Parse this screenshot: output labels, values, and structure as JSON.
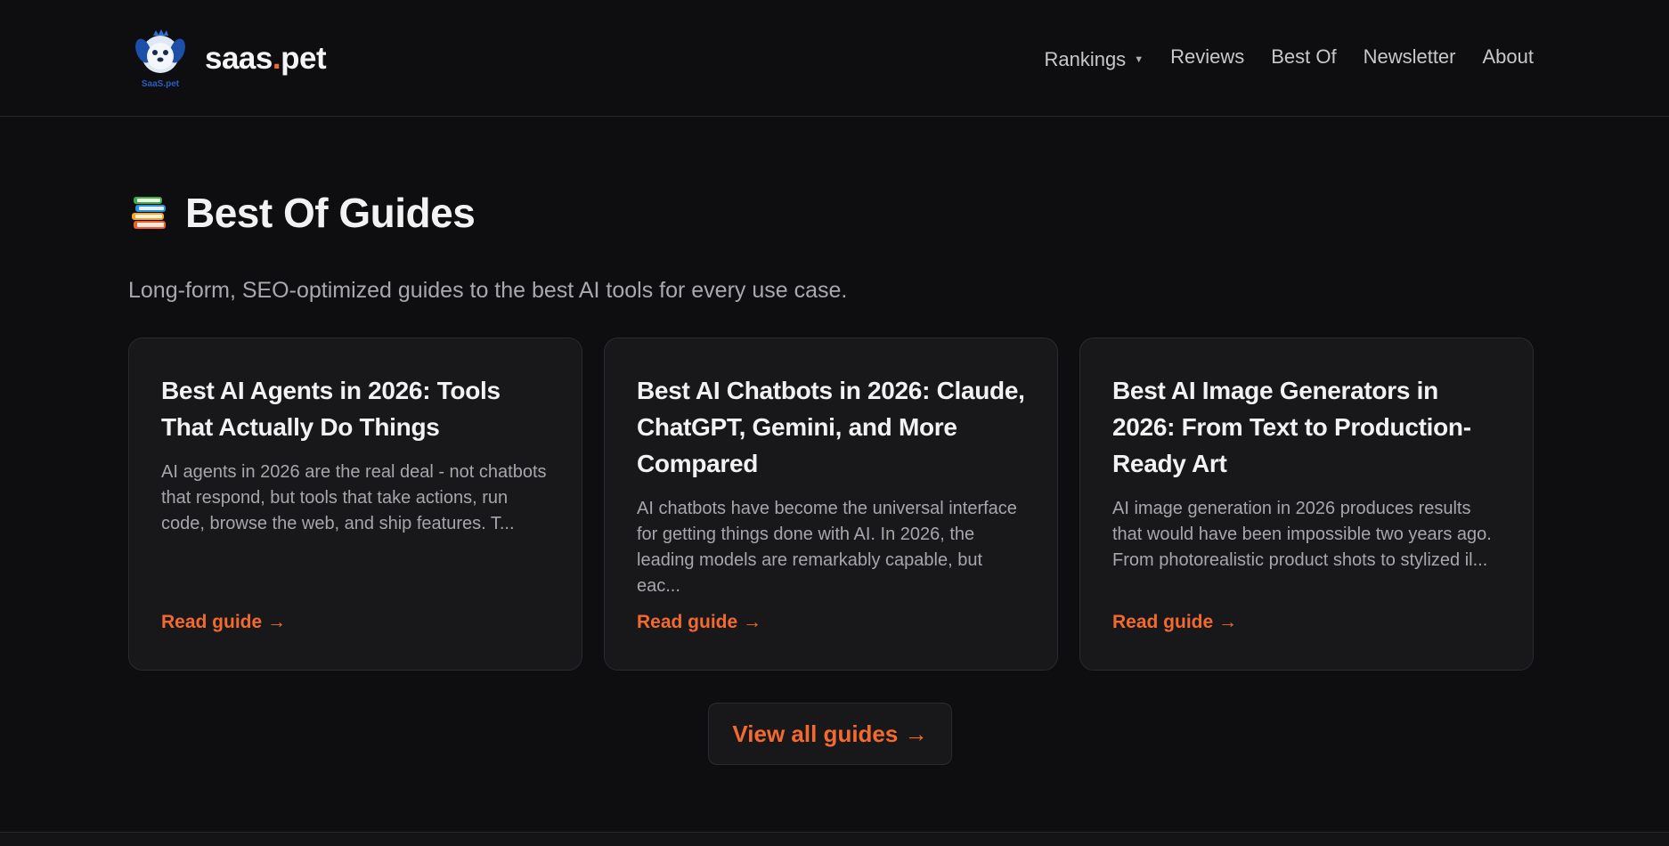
{
  "header": {
    "brand": {
      "name_prefix": "saas",
      "name_dot": ".",
      "name_suffix": "pet",
      "logo_caption": "SaaS.pet",
      "logo_icon": "puppy-logo-icon"
    },
    "nav": [
      {
        "label": "Rankings",
        "has_dropdown": true
      },
      {
        "label": "Reviews"
      },
      {
        "label": "Best Of"
      },
      {
        "label": "Newsletter"
      },
      {
        "label": "About"
      }
    ]
  },
  "main": {
    "title_icon": "books-icon",
    "title": "Best Of Guides",
    "subtitle": "Long-form, SEO-optimized guides to the best AI tools for every use case.",
    "cards": [
      {
        "title": "Best AI Agents in 2026: Tools That Actually Do Things",
        "excerpt": "AI agents in 2026 are the real deal - not chatbots that respond, but tools that take actions, run code, browse the web, and ship features. T...",
        "link_label": "Read guide →"
      },
      {
        "title": "Best AI Chatbots in 2026: Claude, ChatGPT, Gemini, and More Compared",
        "excerpt": "AI chatbots have become the universal interface for getting things done with AI. In 2026, the leading models are remarkably capable, but eac...",
        "link_label": "Read guide →"
      },
      {
        "title": "Best AI Image Generators in 2026: From Text to Production-Ready Art",
        "excerpt": "AI image generation in 2026 produces results that would have been impossible two years ago. From photorealistic product shots to stylized il...",
        "link_label": "Read guide →"
      }
    ],
    "view_all_label": "View all guides →"
  },
  "colors": {
    "background": "#0e0e11",
    "card_background": "#18181b",
    "accent": "#f26a2f",
    "text_primary": "#f2f2f2",
    "text_muted": "#a7a7ab"
  }
}
